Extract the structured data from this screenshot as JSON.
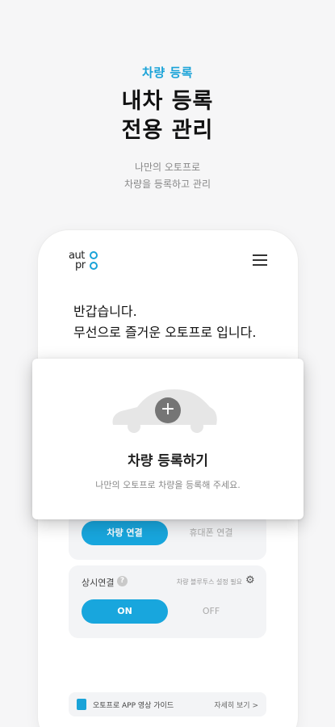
{
  "hero": {
    "tag": "차량 등록",
    "title_line1": "내차 등록",
    "title_line2": "전용 관리",
    "sub_line1": "나만의 오토프로",
    "sub_line2": "차량을 등록하고 관리"
  },
  "app": {
    "logo_top": "aut",
    "logo_bottom": "pr",
    "greeting_line1": "반갑습니다.",
    "greeting_line2": "무선으로 즐거운 오토프로 입니다."
  },
  "connect": {
    "primary": "차량 연결",
    "secondary": "휴대폰 연결"
  },
  "always": {
    "label": "상시연결",
    "help": "?",
    "note": "차량 블루투스 설정 필요",
    "on": "ON",
    "off": "OFF"
  },
  "guide": {
    "text": "오토프로 APP 영상 가이드",
    "more": "자세히 보기 >"
  },
  "register": {
    "plus": "+",
    "title": "차량 등록하기",
    "subtitle": "나만의 오토프로 차량을 등록해 주세요."
  },
  "colors": {
    "accent": "#18a6dd",
    "background": "#f6f6f7"
  },
  "icons": [
    "menu-icon",
    "help-icon",
    "gear-icon",
    "video-guide-icon",
    "car-silhouette-icon",
    "plus-icon"
  ]
}
